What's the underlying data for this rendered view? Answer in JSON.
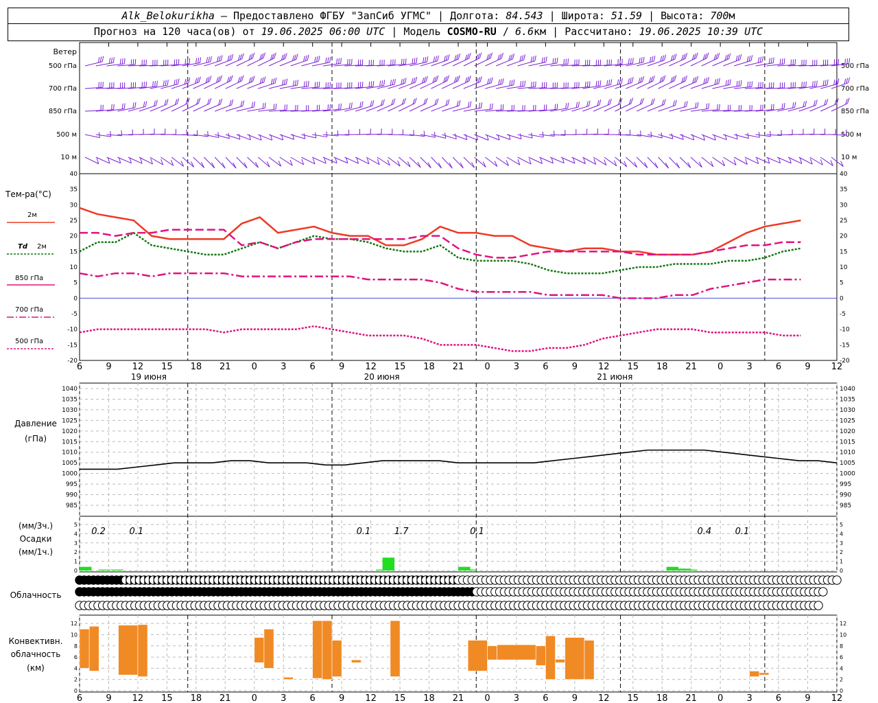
{
  "header": {
    "station": "Alk_Belokurikha",
    "dash": " – ",
    "provider": "Предоставлено ФГБУ \"ЗапСиб УГМС\"",
    "lon_label": "Долгота:",
    "lon": "84.543",
    "lat_label": "Широта:",
    "lat": "51.59",
    "alt_label": "Высота:",
    "alt": "700",
    "alt_unit": "м",
    "sep": " | ",
    "forecast_a": "Прогноз на 120 часа(ов) от",
    "forecast_date": "19.06.2025 06:00 UTC",
    "model_label": "Модель",
    "model": "COSMO-RU",
    "slash": " / ",
    "res": "6.6",
    "res_unit": "км",
    "calc_label": "Рассчитано:",
    "calc_date": "19.06.2025 10:39 UTC"
  },
  "labels": {
    "wind": "Ветер",
    "levels": [
      "500 гПа",
      "700 гПа",
      "850 гПа",
      "500  м",
      "10   м"
    ],
    "temp_title": "Тем-ра(°С)",
    "t2m": "2м",
    "td_a": "Td",
    "td_b": "2м",
    "t850": "850 гПа",
    "t700": "700 гПа",
    "t500": "500 гПа",
    "pressure_a": "Давление",
    "pressure_b": "(гПа)",
    "precip_a": "(мм/3ч.)",
    "precip_b": "Осадки",
    "precip_c": "(мм/1ч.)",
    "cloud": "Облачность",
    "conv_a": "Конвективн.",
    "conv_b": "облачность",
    "conv_c": "(км)"
  },
  "days": [
    "19 июня",
    "20 июня",
    "21 июня"
  ],
  "colors": {
    "wind": "#7b1fd6",
    "t2m": "#ee3a24",
    "td": "#117711",
    "t850": "#e0117f",
    "t700": "#e0117f",
    "t500": "#e0117f",
    "pressure": "#000000",
    "precip": "#22dd22",
    "conv": "#f08a24",
    "zero_line": "#3333cc"
  },
  "chart_data": [
    {
      "type": "line",
      "name": "temperature",
      "x_hours": [
        0,
        3,
        6,
        9,
        12,
        15,
        18,
        21,
        24,
        27,
        30,
        33,
        36,
        39,
        42,
        45,
        48,
        51,
        54,
        57,
        60,
        63,
        66,
        69,
        72,
        75,
        78
      ],
      "ylim": [
        -20,
        40
      ],
      "yticks": [
        -20,
        -15,
        -10,
        -5,
        0,
        5,
        10,
        15,
        20,
        25,
        30,
        35,
        40
      ],
      "series": [
        {
          "name": "2м",
          "values": [
            29,
            27,
            26,
            25,
            20,
            19,
            19,
            19,
            19,
            24,
            26,
            21,
            22,
            23,
            21,
            20,
            20,
            17,
            17,
            19,
            23,
            21,
            21,
            20,
            20,
            17,
            16
          ]
        },
        {
          "name": "Td 2м",
          "values": [
            15,
            18,
            18,
            21,
            17,
            16,
            15,
            14,
            14,
            16,
            18,
            16,
            18,
            20,
            19,
            19,
            18,
            16,
            15,
            15,
            17,
            13,
            12,
            12,
            12,
            11,
            9
          ]
        },
        {
          "name": "850 гПа",
          "values": [
            21,
            21,
            20,
            21,
            21,
            22,
            22,
            22,
            22,
            17,
            18,
            16,
            18,
            19,
            19,
            19,
            19,
            19,
            19,
            20,
            20,
            16,
            14,
            13,
            13,
            14,
            15
          ]
        },
        {
          "name": "700 гПа",
          "values": [
            8,
            7,
            8,
            8,
            7,
            8,
            8,
            8,
            8,
            7,
            7,
            7,
            7,
            7,
            7,
            7,
            6,
            6,
            6,
            6,
            5,
            3,
            2,
            2,
            2,
            2,
            1
          ]
        },
        {
          "name": "500 гПа",
          "values": [
            -11,
            -10,
            -10,
            -10,
            -10,
            -10,
            -10,
            -10,
            -11,
            -10,
            -10,
            -10,
            -10,
            -9,
            -10,
            -11,
            -12,
            -12,
            -12,
            -13,
            -15,
            -15,
            -15,
            -16,
            -17,
            -17,
            -16
          ]
        }
      ],
      "series_day4": {
        "x_hours": [
          81,
          84,
          87,
          90,
          93,
          96,
          99,
          102,
          105,
          108,
          111,
          114,
          117,
          120
        ],
        "2м": [
          15,
          16,
          16,
          15,
          15,
          14,
          14,
          14,
          15,
          18,
          21,
          23,
          24,
          25
        ],
        "Td 2м": [
          8,
          8,
          8,
          9,
          10,
          10,
          11,
          11,
          11,
          12,
          12,
          13,
          15,
          16
        ],
        "850 гПа": [
          15,
          15,
          15,
          15,
          14,
          14,
          14,
          14,
          15,
          16,
          17,
          17,
          18,
          18
        ],
        "700 гПа": [
          1,
          1,
          1,
          0,
          0,
          0,
          1,
          1,
          3,
          4,
          5,
          6,
          6,
          6
        ],
        "500 гПа": [
          -16,
          -15,
          -13,
          -12,
          -11,
          -10,
          -10,
          -10,
          -11,
          -11,
          -11,
          -11,
          -12,
          -12
        ]
      }
    },
    {
      "type": "line",
      "name": "pressure",
      "ylim": [
        985,
        1040
      ],
      "yticks": [
        985,
        990,
        995,
        1000,
        1005,
        1010,
        1015,
        1020,
        1025,
        1030,
        1035,
        1040
      ],
      "x_hours": [
        0,
        3,
        6,
        9,
        12,
        15,
        18,
        21,
        24,
        27,
        30,
        33,
        36,
        39,
        42,
        45,
        48,
        51,
        54,
        57,
        60,
        63,
        66,
        69,
        72,
        75,
        78,
        81,
        84,
        87,
        90,
        93,
        96,
        99,
        102,
        105,
        108,
        111,
        114,
        117,
        120
      ],
      "values": [
        1002,
        1002,
        1002,
        1003,
        1004,
        1005,
        1005,
        1005,
        1006,
        1006,
        1005,
        1005,
        1005,
        1004,
        1004,
        1005,
        1006,
        1006,
        1006,
        1006,
        1005,
        1005,
        1005,
        1005,
        1005,
        1006,
        1007,
        1008,
        1009,
        1010,
        1011,
        1011,
        1011,
        1011,
        1010,
        1009,
        1008,
        1007,
        1006,
        1006,
        1005
      ]
    },
    {
      "type": "bar",
      "name": "precipitation",
      "ylim": [
        0,
        5
      ],
      "yticks": [
        0,
        1,
        2,
        3,
        4,
        5
      ],
      "bars_hour_start": [
        0,
        3,
        5,
        47,
        48,
        60,
        61,
        93,
        94,
        95,
        96
      ],
      "bars_values": [
        0.4,
        0.1,
        0.1,
        0.1,
        1.4,
        0.4,
        0.1,
        0.4,
        0.2,
        0.2,
        0.1
      ],
      "totals_3h": [
        {
          "hour": 1.5,
          "label": "0.2"
        },
        {
          "hour": 4.5,
          "label": "0.1"
        },
        {
          "hour": 22.5,
          "label": "0.1"
        },
        {
          "hour": 25.5,
          "label": "1.7"
        },
        {
          "hour": 31.5,
          "label": "0.1"
        },
        {
          "hour": 49.5,
          "label": "0.4"
        },
        {
          "hour": 52.5,
          "label": "0.1"
        }
      ]
    },
    {
      "type": "table",
      "name": "cloudiness",
      "rows": 3,
      "step_hours": 1,
      "row_top": "FFFFFFFFFFHHHHHHHHHHHHHHHHHHHHHHHHHHHHHHHHHHHHHHHHHHHHHHHHHHHHHHHHHHHHHHHHHHHHHHHH00000000000000000000000000000000000000000000000000000000000000000000000000000000000",
      "row_mid": "FFFFFFFFFFFFFFFFFFFFFFFFFFFFFFFFFFFFFFFFFFFFFFFFFFFFFFFFFFFFFFFFFFFFFFFFFFFFFFFFFFFFFF0000000000000000000000000000000000000000000000000000000000000000000000000000",
      "row_low": "00000000000000000000000000000000000000000000000000000000000000000000000000000000000000000000000000000000000000000000000000000000000000000000000000000000000000000"
    },
    {
      "type": "bar",
      "name": "convective_cloud",
      "ylim": [
        0,
        13
      ],
      "yticks": [
        0,
        2,
        4,
        6,
        8,
        10,
        12
      ],
      "segments": [
        {
          "h0": 0,
          "h1": 1,
          "base": 4,
          "top": 11
        },
        {
          "h0": 1,
          "h1": 2,
          "base": 3.5,
          "top": 11.5
        },
        {
          "h0": 4,
          "h1": 6,
          "base": 2.8,
          "top": 11.7
        },
        {
          "h0": 6,
          "h1": 7,
          "base": 2.5,
          "top": 11.8
        },
        {
          "h0": 18,
          "h1": 19,
          "base": 5,
          "top": 9.5
        },
        {
          "h0": 19,
          "h1": 20,
          "base": 4,
          "top": 11
        },
        {
          "h0": 21,
          "h1": 22,
          "base": 2,
          "top": 2.4
        },
        {
          "h0": 24,
          "h1": 25,
          "base": 2.2,
          "top": 12.5
        },
        {
          "h0": 25,
          "h1": 26,
          "base": 2,
          "top": 12.5
        },
        {
          "h0": 26,
          "h1": 27,
          "base": 2.5,
          "top": 9
        },
        {
          "h0": 28,
          "h1": 29,
          "base": 5,
          "top": 5.5
        },
        {
          "h0": 32,
          "h1": 33,
          "base": 2.5,
          "top": 12.5
        },
        {
          "h0": 40,
          "h1": 42,
          "base": 3.5,
          "top": 9
        },
        {
          "h0": 42,
          "h1": 43,
          "base": 5.5,
          "top": 8
        },
        {
          "h0": 43,
          "h1": 47,
          "base": 5.5,
          "top": 8.2
        },
        {
          "h0": 47,
          "h1": 48,
          "base": 4.5,
          "top": 8
        },
        {
          "h0": 48,
          "h1": 49,
          "base": 2,
          "top": 9.8
        },
        {
          "h0": 49,
          "h1": 50,
          "base": 5,
          "top": 5.6
        },
        {
          "h0": 50,
          "h1": 52,
          "base": 2,
          "top": 9.5
        },
        {
          "h0": 52,
          "h1": 53,
          "base": 2,
          "top": 9
        },
        {
          "h0": 69,
          "h1": 70,
          "base": 2.5,
          "top": 3.5
        },
        {
          "h0": 70,
          "h1": 71,
          "base": 2.8,
          "top": 3.2
        }
      ]
    }
  ],
  "x_ticks": [
    "6",
    "9",
    "12",
    "15",
    "18",
    "21",
    "0",
    "3",
    "6",
    "9",
    "12",
    "15",
    "18",
    "21",
    "0",
    "3",
    "6",
    "9",
    "12",
    "15",
    "18",
    "21",
    "0",
    "3",
    "6",
    "9",
    "12"
  ]
}
